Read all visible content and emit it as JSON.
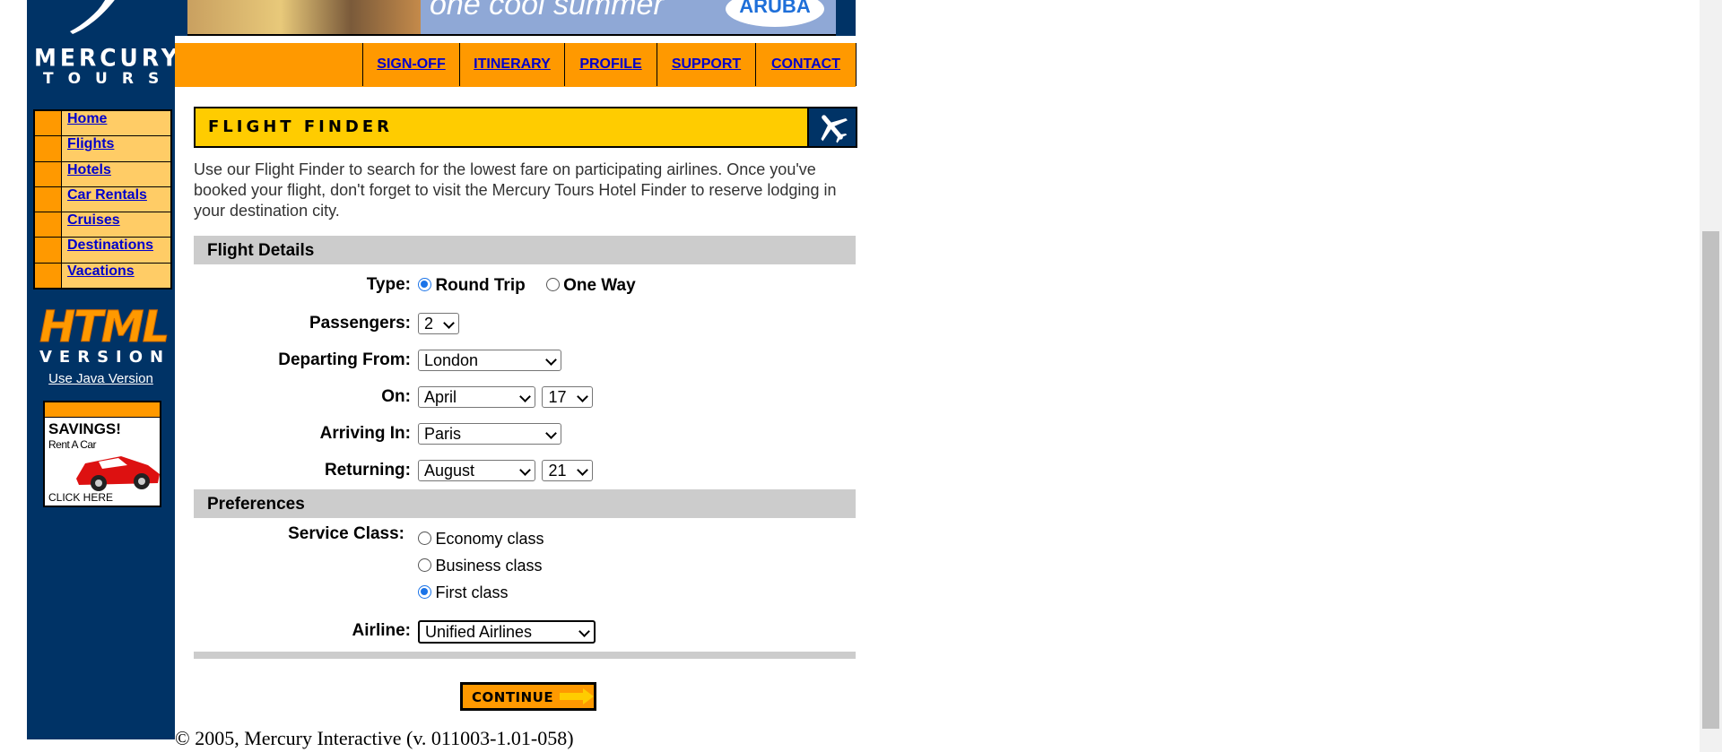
{
  "brand": {
    "name_line1": "MERCURY",
    "name_line2": "TOURS"
  },
  "banner": {
    "slogan": "one cool summer",
    "badge": "ARUBA"
  },
  "topnav": [
    {
      "label": "SIGN-OFF"
    },
    {
      "label": "ITINERARY"
    },
    {
      "label": "PROFILE"
    },
    {
      "label": "SUPPORT"
    },
    {
      "label": "CONTACT"
    }
  ],
  "sidebar": {
    "items": [
      {
        "label": "Home"
      },
      {
        "label": "Flights"
      },
      {
        "label": "Hotels"
      },
      {
        "label": "Car Rentals"
      },
      {
        "label": "Cruises"
      },
      {
        "label": "Destinations"
      },
      {
        "label": "Vacations"
      }
    ],
    "html_version": {
      "big": "HTML",
      "small": "VERSION"
    },
    "java_link": "Use Java Version",
    "promo": {
      "headline": "SAVINGS!",
      "sub": "Rent A Car",
      "cta": "CLICK HERE"
    }
  },
  "page": {
    "title": "FLIGHT FINDER",
    "intro": "Use our Flight Finder to search for the lowest fare on participating airlines. Once you've booked your flight, don't forget to visit the Mercury Tours Hotel Finder to reserve lodging in your destination city."
  },
  "flight_details": {
    "section_label": "Flight Details",
    "type": {
      "label": "Type:",
      "options": [
        "Round Trip",
        "One Way"
      ],
      "selected": "Round Trip"
    },
    "passengers": {
      "label": "Passengers:",
      "value": "2"
    },
    "departing": {
      "label": "Departing From:",
      "value": "London"
    },
    "on": {
      "label": "On:",
      "month": "April",
      "day": "17"
    },
    "arriving": {
      "label": "Arriving In:",
      "value": "Paris"
    },
    "returning": {
      "label": "Returning:",
      "month": "August",
      "day": "21"
    }
  },
  "preferences": {
    "section_label": "Preferences",
    "service_class": {
      "label": "Service Class:",
      "options": [
        "Economy class",
        "Business class",
        "First class"
      ],
      "selected": "First class"
    },
    "airline": {
      "label": "Airline:",
      "value": "Unified Airlines"
    }
  },
  "continue_label": "CONTINUE",
  "footer": "© 2005, Mercury Interactive (v. 011003-1.01-058)",
  "colors": {
    "navy": "#003366",
    "orange": "#ff9900",
    "yellow": "#ffcc00",
    "link": "#0000cc",
    "accent": "#1a73e8"
  }
}
